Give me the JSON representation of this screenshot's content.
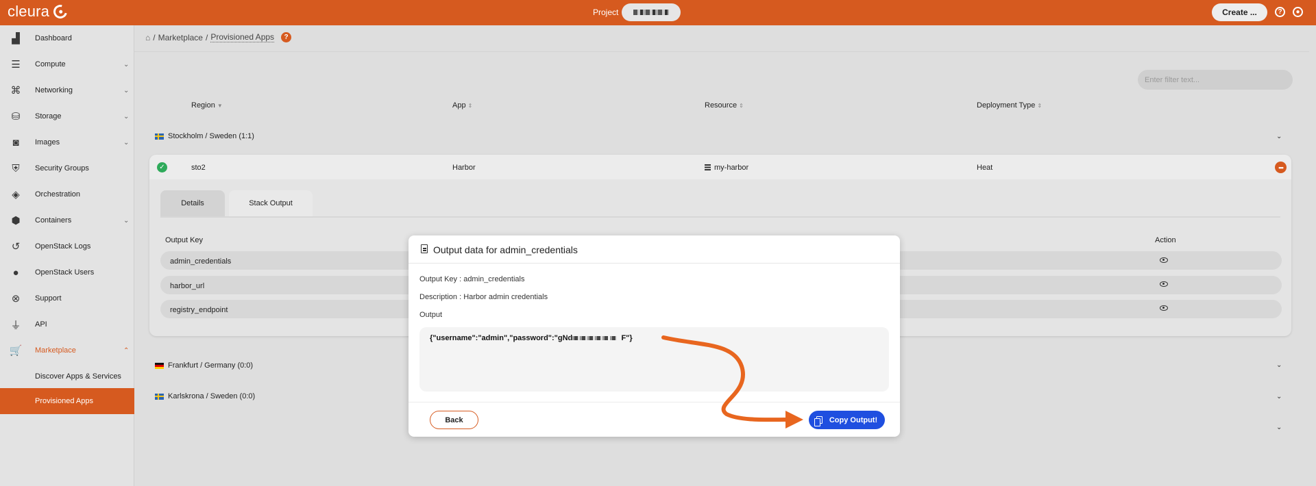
{
  "app": {
    "brand": "cleura"
  },
  "topbar": {
    "project_label": "Project",
    "create_label": "Create ...",
    "help_icon": "question-circle-icon",
    "user_icon": "user-circle-icon"
  },
  "sidebar": {
    "items": [
      {
        "label": "Dashboard",
        "icon": "chart-icon"
      },
      {
        "label": "Compute",
        "icon": "servers-icon",
        "expandable": true
      },
      {
        "label": "Networking",
        "icon": "network-icon",
        "expandable": true
      },
      {
        "label": "Storage",
        "icon": "database-icon",
        "expandable": true
      },
      {
        "label": "Images",
        "icon": "camera-icon",
        "expandable": true
      },
      {
        "label": "Security Groups",
        "icon": "shield-icon"
      },
      {
        "label": "Orchestration",
        "icon": "layers-icon"
      },
      {
        "label": "Containers",
        "icon": "box-icon",
        "expandable": true
      },
      {
        "label": "OpenStack Logs",
        "icon": "history-icon"
      },
      {
        "label": "OpenStack Users",
        "icon": "user-icon"
      },
      {
        "label": "Support",
        "icon": "lifebuoy-icon"
      },
      {
        "label": "API",
        "icon": "plug-icon"
      },
      {
        "label": "Marketplace",
        "icon": "cart-icon",
        "expandable": true,
        "expanded": true
      }
    ],
    "sub_items": [
      {
        "label": "Discover Apps & Services"
      },
      {
        "label": "Provisioned Apps",
        "selected": true
      }
    ]
  },
  "breadcrumb": {
    "parent": "Marketplace",
    "current": "Provisioned Apps"
  },
  "filter": {
    "placeholder": "Enter filter text..."
  },
  "table": {
    "columns": [
      "Region",
      "App",
      "Resource",
      "Deployment Type"
    ],
    "groups": [
      {
        "label": "Stockholm / Sweden (1:1)",
        "flag": "se"
      },
      {
        "label": "Frankfurt / Germany (0:0)",
        "flag": "de"
      },
      {
        "label": "Karlskrona / Sweden (0:0)",
        "flag": "se"
      }
    ],
    "row": {
      "region": "sto2",
      "app": "Harbor",
      "resource": "my-harbor",
      "deployment_type": "Heat"
    }
  },
  "tabs": [
    "Details",
    "Stack Output"
  ],
  "outputs": {
    "col_key": "Output Key",
    "col_action": "Action",
    "rows": [
      "admin_credentials",
      "harbor_url",
      "registry_endpoint"
    ]
  },
  "modal": {
    "title": "Output data for admin_credentials",
    "key_line": "Output Key : admin_credentials",
    "desc_line": "Description : Harbor admin credentials",
    "output_label": "Output",
    "output_prefix": "{\"username\":\"admin\",\"password\":\"gNd",
    "output_suffix": "F\"}",
    "back_label": "Back",
    "copy_label": "Copy Output!"
  },
  "colors": {
    "accent": "#d65a1f",
    "primary_button": "#1f4fe0",
    "success": "#2eaa5a"
  }
}
